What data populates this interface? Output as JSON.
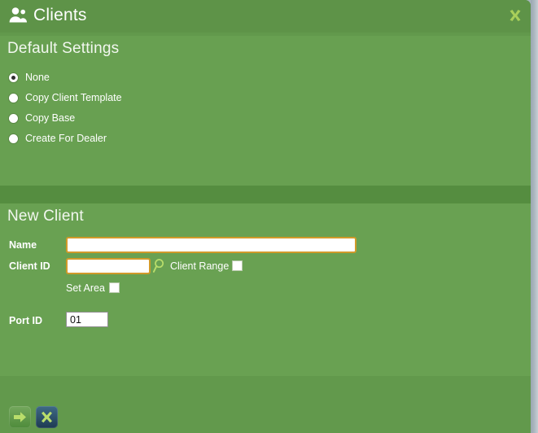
{
  "window": {
    "title": "Clients",
    "icon": "people-icon",
    "close_label": "✕",
    "accent_green": "#62994c",
    "header_green": "#5e9348",
    "panel_green": "#68a051",
    "divider_green": "#558d40",
    "close_icon_color": "#a9cf5a",
    "input_border_orange": "#d19a2a",
    "backdrop_gray": "#a8b4bd"
  },
  "default_settings": {
    "title": "Default Settings",
    "options": [
      {
        "label": "None",
        "selected": true
      },
      {
        "label": "Copy Client Template",
        "selected": false
      },
      {
        "label": "Copy Base",
        "selected": false
      },
      {
        "label": "Create For Dealer",
        "selected": false
      }
    ]
  },
  "new_client": {
    "title": "New Client",
    "fields": {
      "name": {
        "label": "Name",
        "value": "",
        "placeholder": ""
      },
      "client_id": {
        "label": "Client ID",
        "value": "",
        "placeholder": ""
      },
      "port_id": {
        "label": "Port ID",
        "value": "01",
        "placeholder": ""
      }
    },
    "lookup_icon": "magnifier-icon",
    "checkboxes": [
      {
        "label": "Client Range",
        "checked": false
      },
      {
        "label": "Set Area",
        "checked": false
      }
    ]
  },
  "footer": {
    "submit_icon": "arrow-right-icon",
    "cancel_icon": "close-x-icon"
  }
}
